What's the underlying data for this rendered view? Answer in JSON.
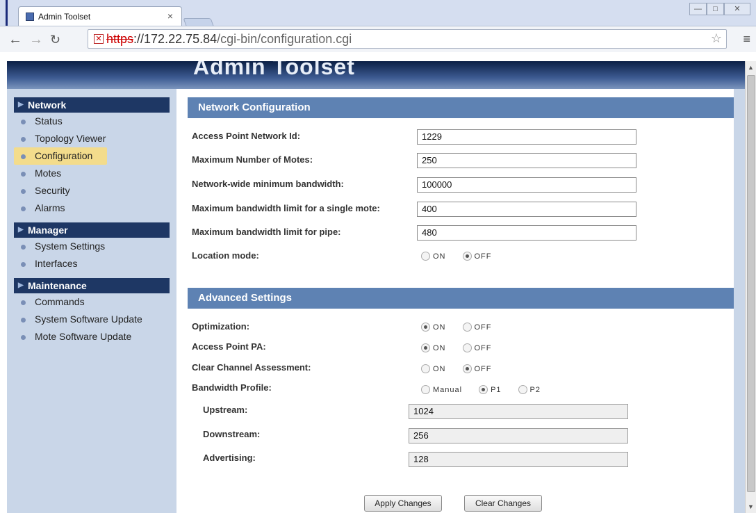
{
  "browser": {
    "tab_title": "Admin Toolset",
    "tab_close": "×",
    "url_scheme": "https",
    "url_rest": "://172.22.75.84",
    "url_path": "/cgi-bin/configuration.cgi"
  },
  "header": {
    "title": "Admin Toolset"
  },
  "sidebar": {
    "sections": [
      {
        "title": "Network",
        "items": [
          "Status",
          "Topology Viewer",
          "Configuration",
          "Motes",
          "Security",
          "Alarms"
        ]
      },
      {
        "title": "Manager",
        "items": [
          "System Settings",
          "Interfaces"
        ]
      },
      {
        "title": "Maintenance",
        "items": [
          "Commands",
          "System Software Update",
          "Mote Software Update"
        ]
      }
    ],
    "active_item": "Configuration"
  },
  "network_config": {
    "title": "Network Configuration",
    "fields": [
      {
        "label": "Access Point Network Id:",
        "value": "1229"
      },
      {
        "label": "Maximum Number of Motes:",
        "value": "250"
      },
      {
        "label": "Network-wide minimum bandwidth:",
        "value": "100000"
      },
      {
        "label": "Maximum bandwidth limit for a single mote:",
        "value": "400"
      },
      {
        "label": "Maximum bandwidth limit for pipe:",
        "value": "480"
      }
    ],
    "location_mode": {
      "label": "Location mode:",
      "on": "ON",
      "off": "OFF",
      "selected": "OFF"
    }
  },
  "advanced": {
    "title": "Advanced Settings",
    "optimization": {
      "label": "Optimization:",
      "on": "ON",
      "off": "OFF",
      "selected": "ON"
    },
    "access_point_pa": {
      "label": "Access Point PA:",
      "on": "ON",
      "off": "OFF",
      "selected": "ON"
    },
    "cca": {
      "label": "Clear Channel Assessment:",
      "on": "ON",
      "off": "OFF",
      "selected": "OFF"
    },
    "bandwidth_profile": {
      "label": "Bandwidth Profile:",
      "options": [
        "Manual",
        "P1",
        "P2"
      ],
      "selected": "P1"
    },
    "upstream": {
      "label": "Upstream:",
      "value": "1024"
    },
    "downstream": {
      "label": "Downstream:",
      "value": "256"
    },
    "advertising": {
      "label": "Advertising:",
      "value": "128"
    }
  },
  "buttons": {
    "apply": "Apply Changes",
    "clear": "Clear Changes"
  }
}
